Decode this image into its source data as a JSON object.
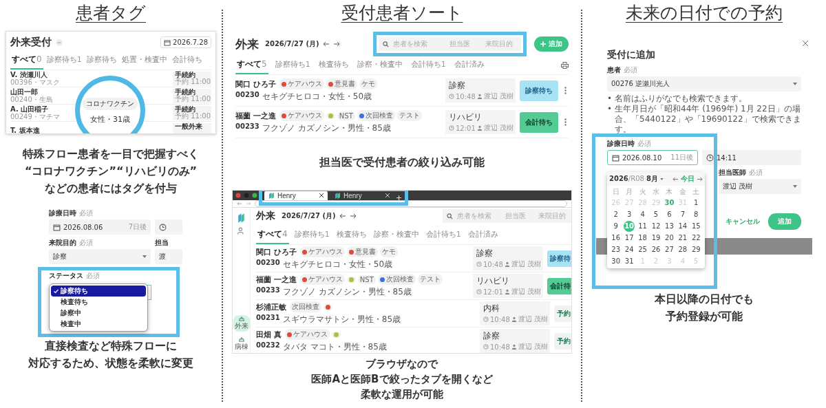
{
  "patient_tags": {
    "title": "患者タグ",
    "list_screen": {
      "title": "外来受付",
      "date": "2026.7.28",
      "tabs": [
        {
          "label": "すべて",
          "count": "0",
          "selected": true
        },
        {
          "label": "診察待ち",
          "count": "1",
          "selected": false
        },
        {
          "label": "診察待ち",
          "selected": false
        },
        {
          "label": "処置・検査中",
          "selected": false
        },
        {
          "label": "会計待ち",
          "selected": false
        }
      ],
      "rows": [
        {
          "name": "V. 渋瀬川人",
          "detail": "00396・マスク",
          "status": "手続約",
          "time": "予約 11:00"
        },
        {
          "name": "山田一郎",
          "detail": "00240・生島",
          "status": "手続約",
          "time": "予約 11:00"
        },
        {
          "name": "A. 山田稲子",
          "detail": "00249・マチマ",
          "status": "手続約",
          "time": "予約 11:00"
        },
        {
          "name": "T. 坂本進",
          "status": "一般外来"
        }
      ],
      "magnifier": {
        "tag": "コロナワクチン",
        "detail": "女性・31歳"
      }
    },
    "caption": [
      "特殊フロー患者を一目で把握すべく",
      "“コロナワクチン”“リハビリのみ”",
      "などの患者にはタグを付与"
    ],
    "form_screen": {
      "date_label": {
        "text": "診療日時",
        "required": "必須"
      },
      "date": "2026.08.06",
      "relative": "7日後",
      "purpose_label": {
        "text": "来院目的",
        "required": "必須"
      },
      "purpose": "診察",
      "doctor_label": "担当",
      "doctor": "渡",
      "status_label": {
        "text": "ステータス",
        "required": "必須"
      },
      "status_options": [
        {
          "label": "診察待ち",
          "selected": true
        },
        {
          "label": "検査待ち",
          "selected": false
        },
        {
          "label": "診察中",
          "selected": false
        },
        {
          "label": "検査中",
          "selected": false
        }
      ]
    },
    "caption2": [
      "直接検査など特殊フローに",
      "対応するため、状態を柔軟に変更"
    ]
  },
  "reception_sort": {
    "title": "受付患者ソート",
    "list_screen": {
      "title": "外来",
      "date": "2026/7/27 (月)",
      "search_placeholder": "患者を検索",
      "filters": [
        "担当医",
        "来院目的"
      ],
      "add_button": "追加",
      "tabs": [
        {
          "label": "すべて",
          "count": "5",
          "selected": true
        },
        {
          "label": "診察待ち",
          "count": "1",
          "selected": false
        },
        {
          "label": "検査待ち",
          "selected": false
        },
        {
          "label": "診察・検査中",
          "selected": false
        },
        {
          "label": "会計待ち",
          "count": "1",
          "selected": false
        },
        {
          "label": "会計済み",
          "selected": false
        }
      ],
      "rows": [
        {
          "name": "関口 ひろ子",
          "tags": [
            {
              "label": "ケアハウス",
              "color": "#e2483b"
            },
            {
              "label": "意見書",
              "color": "#e2483b"
            },
            {
              "label": "ケモ"
            }
          ],
          "id": "00230",
          "detail": "セキグチヒロコ・女性・50歳",
          "visit": "診察",
          "time": "10:48",
          "doctor": "渡辺 茂樹",
          "status": "診察待ち",
          "kind": "exam"
        },
        {
          "name": "福薗 一之進",
          "tags": [
            {
              "label": "ケアハウス",
              "color": "#e2483b"
            },
            {
              "color": "#a9c23a"
            },
            {
              "label": "NST"
            },
            {
              "label": "次回検査",
              "color": "#3f6fd8"
            },
            {
              "label": "テスト"
            }
          ],
          "id": "00233",
          "detail": "フクゾノ カズノシン・男性・85歳",
          "visit": "リハビリ",
          "time": "12:01",
          "doctor": "渡辺 茂樹",
          "status": "会計待ち",
          "kind": "billing"
        }
      ]
    },
    "caption": "担当医で受付患者の絞り込み可能",
    "browser": {
      "tabs": [
        {
          "label": "Henry",
          "selected": true
        },
        {
          "label": "Henry",
          "selected": false
        }
      ],
      "nav": [
        {
          "label": "外来",
          "selected": true
        },
        {
          "label": "病棟",
          "selected": false
        }
      ],
      "screen": {
        "title": "外来",
        "date": "2026/7/27 (月)",
        "search_placeholder": "患者を検索",
        "filters": [
          "担当医",
          "来院目的"
        ],
        "tabs": [
          {
            "label": "すべて",
            "count": "4",
            "selected": true
          },
          {
            "label": "診察待ち",
            "count": "1",
            "selected": false
          },
          {
            "label": "検査待ち",
            "selected": false
          },
          {
            "label": "診察・検査中",
            "selected": false
          },
          {
            "label": "会計待ち",
            "count": "1",
            "selected": false
          },
          {
            "label": "会計済み",
            "selected": false
          }
        ],
        "rows": [
          {
            "name": "関口 ひろ子",
            "tags": [
              {
                "label": "ケアハウス",
                "color": "#e2483b"
              },
              {
                "label": "意見書",
                "color": "#e2483b"
              },
              {
                "label": "ケモ"
              }
            ],
            "id": "00230",
            "detail": "セキグチヒロコ・女性・50歳",
            "visit": "診察",
            "time": "10:48",
            "doctor": "渡辺 茂樹",
            "status": "診察待",
            "kind": "exam"
          },
          {
            "name": "福薗 一之進",
            "tags": [
              {
                "label": "ケアハウス",
                "color": "#e2483b"
              },
              {
                "color": "#a9c23a"
              },
              {
                "label": "NST"
              },
              {
                "label": "次回検査",
                "color": "#3f6fd8"
              },
              {
                "label": "テスト"
              }
            ],
            "id": "00233",
            "detail": "フクゾノ カズノシン・男性・85歳",
            "visit": "リハビリ",
            "time": "12:01",
            "doctor": "渡辺 茂樹",
            "status": "会計待",
            "kind": "billing"
          },
          {
            "name": "杉浦正敏",
            "tags": [
              {
                "label": "次回検査"
              },
              {
                "color": "#e2483b"
              }
            ],
            "id": "00231",
            "detail": "スギウラマサトシ・男性・85歳",
            "visit": "内科",
            "time": "10:48",
            "doctor": "渡辺 茂樹",
            "status": "予約",
            "kind": "reserved"
          },
          {
            "name": "田畑 真",
            "tags": [
              {
                "label": "ケアハウス",
                "color": "#e2483b"
              },
              {
                "color": "#a9c23a"
              }
            ],
            "id": "00232",
            "detail": "タバタ マコト・男性・85歳",
            "visit": "診察",
            "time": "10:48",
            "doctor": "渡辺 茂樹",
            "status": "予約",
            "kind": "reserved"
          }
        ]
      }
    },
    "caption2": [
      "ブラウザなので",
      "医師Aと医師Bで絞ったタブを開くなど",
      "柔軟な運用が可能"
    ]
  },
  "future_booking": {
    "title": "未来の日付での予約",
    "dialog": {
      "title": "受付に追加",
      "patient_label": {
        "text": "患者",
        "required": "必須"
      },
      "patient": "00276 逆瀬川光人",
      "hints": [
        {
          "marker": "•",
          "text": "名前はふりがなでも検索できます。"
        },
        {
          "marker": "•",
          "text": "生年月日が「昭和44年 (1969年) 1月 22日」の場合、「5440122」や「19690122」で検索できます。"
        }
      ],
      "date_label": {
        "text": "診療日時",
        "required": "必須"
      },
      "date": "2026.08.10",
      "relative": "11日後",
      "time": "14:11",
      "doctor_label": {
        "text": "担当医師",
        "required": "必須"
      },
      "doctor": "渡辺 茂樹",
      "cancel_button": "キャンセル",
      "add_button": "追加",
      "calendar": {
        "month": "**2026**/R08 **8月**",
        "today_button": "今日",
        "weekdays": [
          "日",
          "月",
          "火",
          "水",
          "木",
          "金",
          "土"
        ],
        "weeks": [
          [
            {
              "label": "26",
              "in_month": false,
              "today": false,
              "selected": false
            },
            {
              "label": "27",
              "in_month": false,
              "today": false,
              "selected": false
            },
            {
              "label": "28",
              "in_month": false,
              "today": false,
              "selected": false
            },
            {
              "label": "29",
              "in_month": false,
              "today": false,
              "selected": false
            },
            {
              "label": "30",
              "in_month": false,
              "today": true,
              "selected": false
            },
            {
              "label": "31",
              "in_month": false,
              "today": false,
              "selected": false
            },
            {
              "label": "1",
              "in_month": true,
              "today": false,
              "selected": false
            }
          ],
          [
            {
              "label": "2",
              "in_month": true,
              "today": false,
              "selected": false
            },
            {
              "label": "3",
              "in_month": true,
              "today": false,
              "selected": false
            },
            {
              "label": "4",
              "in_month": true,
              "today": false,
              "selected": false
            },
            {
              "label": "5",
              "in_month": true,
              "today": false,
              "selected": false
            },
            {
              "label": "6",
              "in_month": true,
              "today": false,
              "selected": false
            },
            {
              "label": "7",
              "in_month": true,
              "today": false,
              "selected": false
            },
            {
              "label": "8",
              "in_month": true,
              "today": false,
              "selected": false
            }
          ],
          [
            {
              "label": "9",
              "in_month": true,
              "today": false,
              "selected": false
            },
            {
              "label": "10",
              "in_month": true,
              "today": false,
              "selected": true
            },
            {
              "label": "11",
              "in_month": true,
              "today": false,
              "selected": false
            },
            {
              "label": "12",
              "in_month": true,
              "today": false,
              "selected": false
            },
            {
              "label": "13",
              "in_month": true,
              "today": false,
              "selected": false
            },
            {
              "label": "14",
              "in_month": true,
              "today": false,
              "selected": false
            },
            {
              "label": "15",
              "in_month": true,
              "today": false,
              "selected": false
            }
          ],
          [
            {
              "label": "16",
              "in_month": true,
              "today": false,
              "selected": false
            },
            {
              "label": "17",
              "in_month": true,
              "today": false,
              "selected": false
            },
            {
              "label": "18",
              "in_month": true,
              "today": false,
              "selected": false
            },
            {
              "label": "19",
              "in_month": true,
              "today": false,
              "selected": false
            },
            {
              "label": "20",
              "in_month": true,
              "today": false,
              "selected": false
            },
            {
              "label": "21",
              "in_month": true,
              "today": false,
              "selected": false
            },
            {
              "label": "22",
              "in_month": true,
              "today": false,
              "selected": false
            }
          ],
          [
            {
              "label": "23",
              "in_month": true,
              "today": false,
              "selected": false
            },
            {
              "label": "24",
              "in_month": true,
              "today": false,
              "selected": false
            },
            {
              "label": "25",
              "in_month": true,
              "today": false,
              "selected": false
            },
            {
              "label": "26",
              "in_month": true,
              "today": false,
              "selected": false
            },
            {
              "label": "27",
              "in_month": true,
              "today": false,
              "selected": false
            },
            {
              "label": "28",
              "in_month": true,
              "today": false,
              "selected": false
            },
            {
              "label": "29",
              "in_month": true,
              "today": false,
              "selected": false
            }
          ],
          [
            {
              "label": "30",
              "in_month": true,
              "today": false,
              "selected": false
            },
            {
              "label": "31",
              "in_month": true,
              "today": false,
              "selected": false
            },
            {
              "label": "1",
              "in_month": false,
              "today": false,
              "selected": false
            },
            {
              "label": "2",
              "in_month": false,
              "today": false,
              "selected": false
            },
            {
              "label": "3",
              "in_month": false,
              "today": false,
              "selected": false
            },
            {
              "label": "4",
              "in_month": false,
              "today": false,
              "selected": false
            },
            {
              "label": "5",
              "in_month": false,
              "today": false,
              "selected": false
            }
          ]
        ]
      }
    },
    "caption": [
      "本日以降の日付でも",
      "予約登録が可能"
    ]
  }
}
